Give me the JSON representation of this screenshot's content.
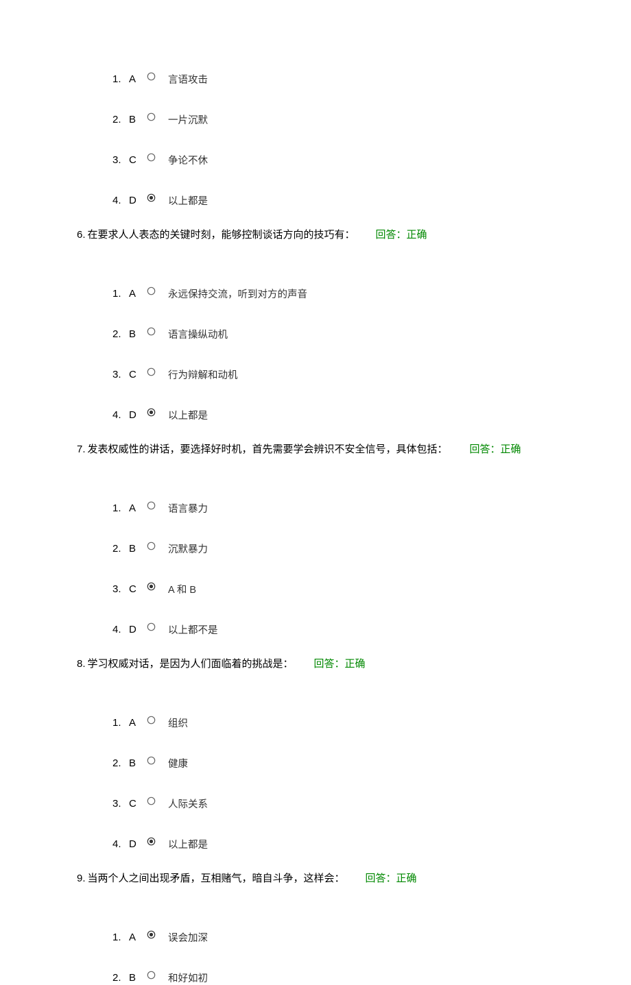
{
  "q5": {
    "options": [
      {
        "num": "1.",
        "letter": "A",
        "text": "言语攻击",
        "selected": false
      },
      {
        "num": "2.",
        "letter": "B",
        "text": "一片沉默",
        "selected": false
      },
      {
        "num": "3.",
        "letter": "C",
        "text": "争论不休",
        "selected": false
      },
      {
        "num": "4.",
        "letter": "D",
        "text": "以上都是",
        "selected": true
      }
    ]
  },
  "q6": {
    "num": "6.",
    "text": "在要求人人表态的关键时刻，能够控制谈话方向的技巧有：",
    "feedback": "回答：正确",
    "options": [
      {
        "num": "1.",
        "letter": "A",
        "text": "永远保持交流，听到对方的声音",
        "selected": false
      },
      {
        "num": "2.",
        "letter": "B",
        "text": "语言操纵动机",
        "selected": false
      },
      {
        "num": "3.",
        "letter": "C",
        "text": "行为辩解和动机",
        "selected": false
      },
      {
        "num": "4.",
        "letter": "D",
        "text": "以上都是",
        "selected": true
      }
    ]
  },
  "q7": {
    "num": "7.",
    "text": " 发表权威性的讲话，要选择好时机，首先需要学会辨识不安全信号，具体包括：",
    "feedback": "回答：正确",
    "options": [
      {
        "num": "1.",
        "letter": "A",
        "text": "语言暴力",
        "selected": false
      },
      {
        "num": "2.",
        "letter": "B",
        "text": "沉默暴力",
        "selected": false
      },
      {
        "num": "3.",
        "letter": "C",
        "text": "A 和 B",
        "selected": true
      },
      {
        "num": "4.",
        "letter": "D",
        "text": "以上都不是",
        "selected": false
      }
    ]
  },
  "q8": {
    "num": "8.",
    "text": " 学习权威对话，是因为人们面临着的挑战是：",
    "feedback": "回答：正确",
    "options": [
      {
        "num": "1.",
        "letter": "A",
        "text": "组织",
        "selected": false
      },
      {
        "num": "2.",
        "letter": "B",
        "text": "健康",
        "selected": false
      },
      {
        "num": "3.",
        "letter": "C",
        "text": "人际关系",
        "selected": false
      },
      {
        "num": "4.",
        "letter": "D",
        "text": "以上都是",
        "selected": true
      }
    ]
  },
  "q9": {
    "num": "9.",
    "text": "当两个人之间出现矛盾，互相赌气，暗自斗争，这样会：",
    "feedback": "回答：正确",
    "options": [
      {
        "num": "1.",
        "letter": "A",
        "text": "误会加深",
        "selected": true
      },
      {
        "num": "2.",
        "letter": "B",
        "text": "和好如初",
        "selected": false
      }
    ]
  }
}
